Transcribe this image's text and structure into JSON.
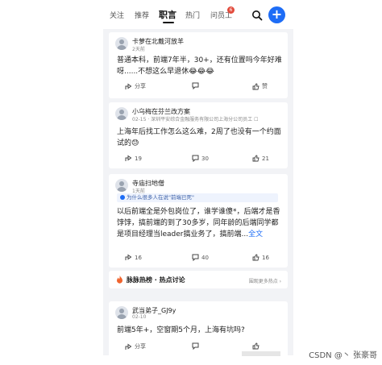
{
  "tabs": [
    {
      "label": "关注",
      "active": false
    },
    {
      "label": "推荐",
      "active": false
    },
    {
      "label": "职言",
      "active": true
    },
    {
      "label": "热门",
      "active": false
    },
    {
      "label": "问员工",
      "active": false,
      "badge": "6"
    }
  ],
  "icons": {
    "search": "search-icon",
    "plus": "plus-button"
  },
  "colors": {
    "accent": "#1e6df6",
    "badge": "#e24a3b"
  },
  "posts": [
    {
      "username": "卡萝在北戴河放羊",
      "meta": "2天前",
      "content": "普通本科，前端7年半，30+，还有位置吗今年好难呀......不想这么早退休😂😂😂",
      "actions": {
        "share": "分享",
        "comments": "",
        "likes": "赞"
      }
    },
    {
      "username": "小乌梅在芬兰改方案",
      "meta": "02-15 · 深圳平安综合金融服务有限公司上海分公司员工 ☐",
      "content": "上海年后找工作怎么这么难，2周了也没有一个约面试的😓",
      "actions": {
        "share": "19",
        "comments": "30",
        "likes": "21"
      }
    },
    {
      "username": "寺庙扫地僧",
      "meta": "1天前",
      "banner": "为什么很多人在说\"前端已死\"",
      "content": "以后前端全是外包岗位了，谁学谁傻*，后端才是香饽饽，搞前端的到了30多岁，同年龄的后端同学都是项目经理当leader搞业务了，搞前端...",
      "more": "全文",
      "actions": {
        "share": "16",
        "comments": "40",
        "likes": "16"
      }
    },
    {
      "username": "武当弟子_GJ9y",
      "meta": "02-10",
      "content": "前端5年+，空窗期5个月，上海有坑吗?",
      "actions": {
        "share": "分享",
        "comments": "",
        "likes": ""
      }
    }
  ],
  "topics": {
    "title": "脉脉热榜 · 热点讨论",
    "more": "围观更多热点 ›"
  },
  "watermark": "CSDN @丶 张豪哥"
}
